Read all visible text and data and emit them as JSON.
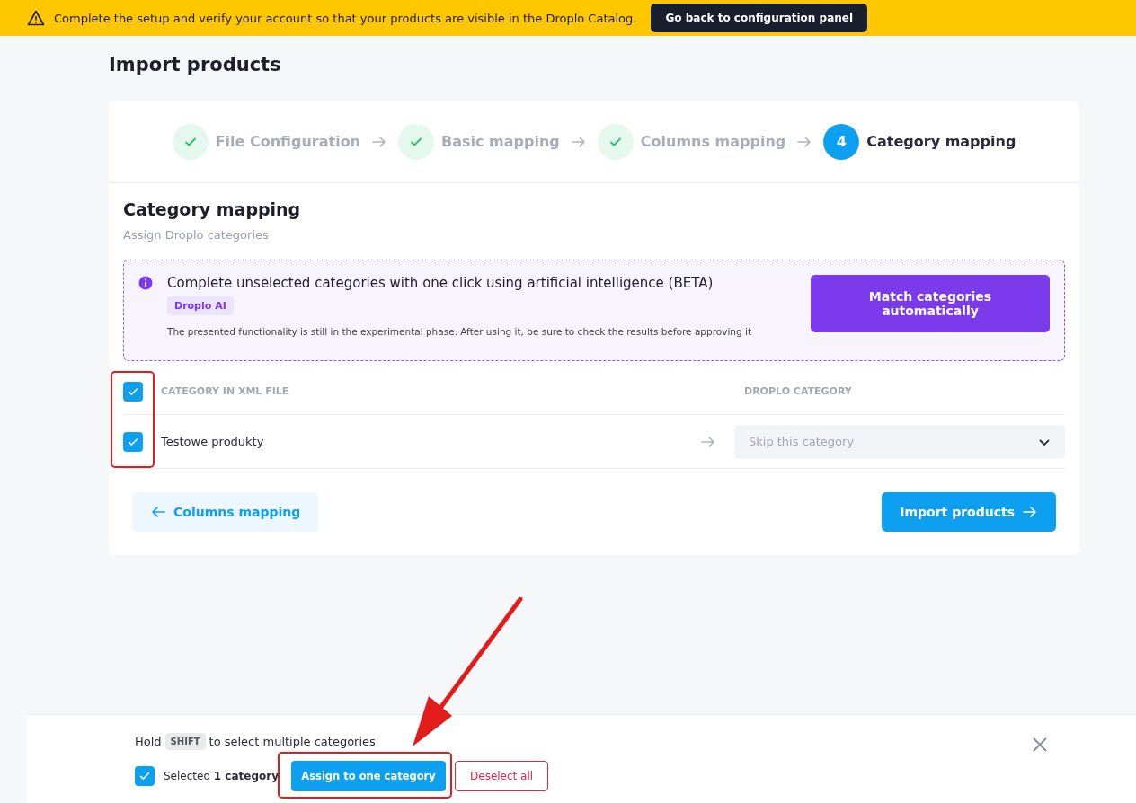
{
  "banner": {
    "message": "Complete the setup and verify your account so that your products are visible in the Droplo Catalog.",
    "button": "Go back to configuration panel"
  },
  "page_title": "Import products",
  "steps": [
    {
      "label": "File Configuration",
      "done": true,
      "selected": false
    },
    {
      "label": "Basic mapping",
      "done": true,
      "selected": false
    },
    {
      "label": "Columns mapping",
      "done": true,
      "selected": false
    },
    {
      "label": "Category mapping",
      "done": false,
      "selected": true,
      "number": "4"
    }
  ],
  "section": {
    "title": "Category mapping",
    "subtitle": "Assign Droplo categories"
  },
  "ai_box": {
    "title": "Complete unselected categories with one click using artificial intelligence (BETA)",
    "tag": "Droplo AI",
    "note": "The presented functionality is still in the experimental phase. After using it, be sure to check the results before approving it",
    "button": "Match categories automatically"
  },
  "table": {
    "select_all_checked": true,
    "columns": [
      "CATEGORY IN XML FILE",
      "DROPLO CATEGORY"
    ],
    "rows": [
      {
        "name": "Testowe produkty",
        "checked": true,
        "placeholder": "Skip this category"
      }
    ]
  },
  "nav": {
    "back": "Columns mapping",
    "next": "Import products"
  },
  "bottom_bar": {
    "hint_before": "Hold",
    "key": "SHIFT",
    "hint_after": "to select multiple categories",
    "all_checked": true,
    "selected_text": "Selected **1 category**",
    "assign": "Assign to one category",
    "deselect": "Deselect all"
  }
}
